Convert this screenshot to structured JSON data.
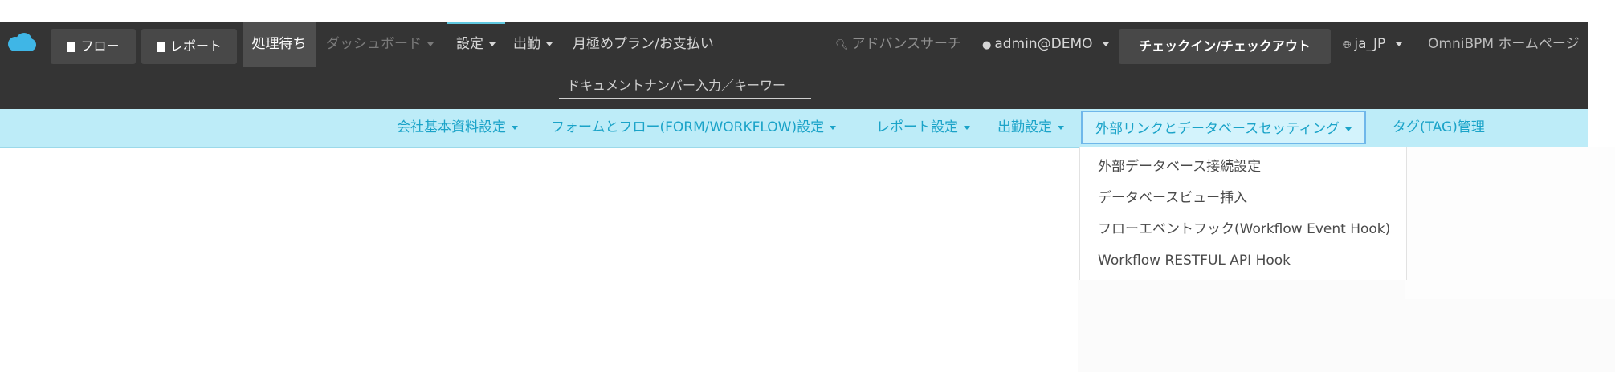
{
  "topbar": {
    "buttons": {
      "flow": "フロー",
      "report": "レポート",
      "pending": "処理待ち"
    },
    "nav": {
      "dashboard": "ダッシュボード",
      "settings": "設定",
      "attendance": "出勤",
      "plan": "月極めプラン/お支払い"
    },
    "right": {
      "advanced_search": "アドバンスサーチ",
      "user": "admin@DEMO",
      "checkin": "チェックイン/チェックアウト",
      "language": "ja_JP",
      "homepage": "OmniBPM ホームページ"
    },
    "search": {
      "placeholder": "ドキュメントナンバー入力／キーワー"
    }
  },
  "subnav": {
    "items": [
      "会社基本資料設定",
      "フォームとフロー(FORM/WORKFLOW)設定",
      "レポート設定",
      "出勤設定",
      "外部リンクとデータベースセッティング",
      "タグ(TAG)管理"
    ]
  },
  "dropdown": {
    "items": [
      "外部データベース接続設定",
      "データベースビュー挿入",
      "フローエベントフック(Workflow Event Hook)",
      "Workflow RESTFUL API Hook"
    ]
  },
  "colors": {
    "topbar": "#343434",
    "subnav": "#bdecf8",
    "subnav_text": "#1aa3c8",
    "logo": "#3fb6e6"
  },
  "icons": [
    "cloud-logo-icon",
    "document-icon",
    "chart-icon",
    "search-icon",
    "user-circle-icon",
    "globe-icon",
    "caret-down-icon"
  ]
}
